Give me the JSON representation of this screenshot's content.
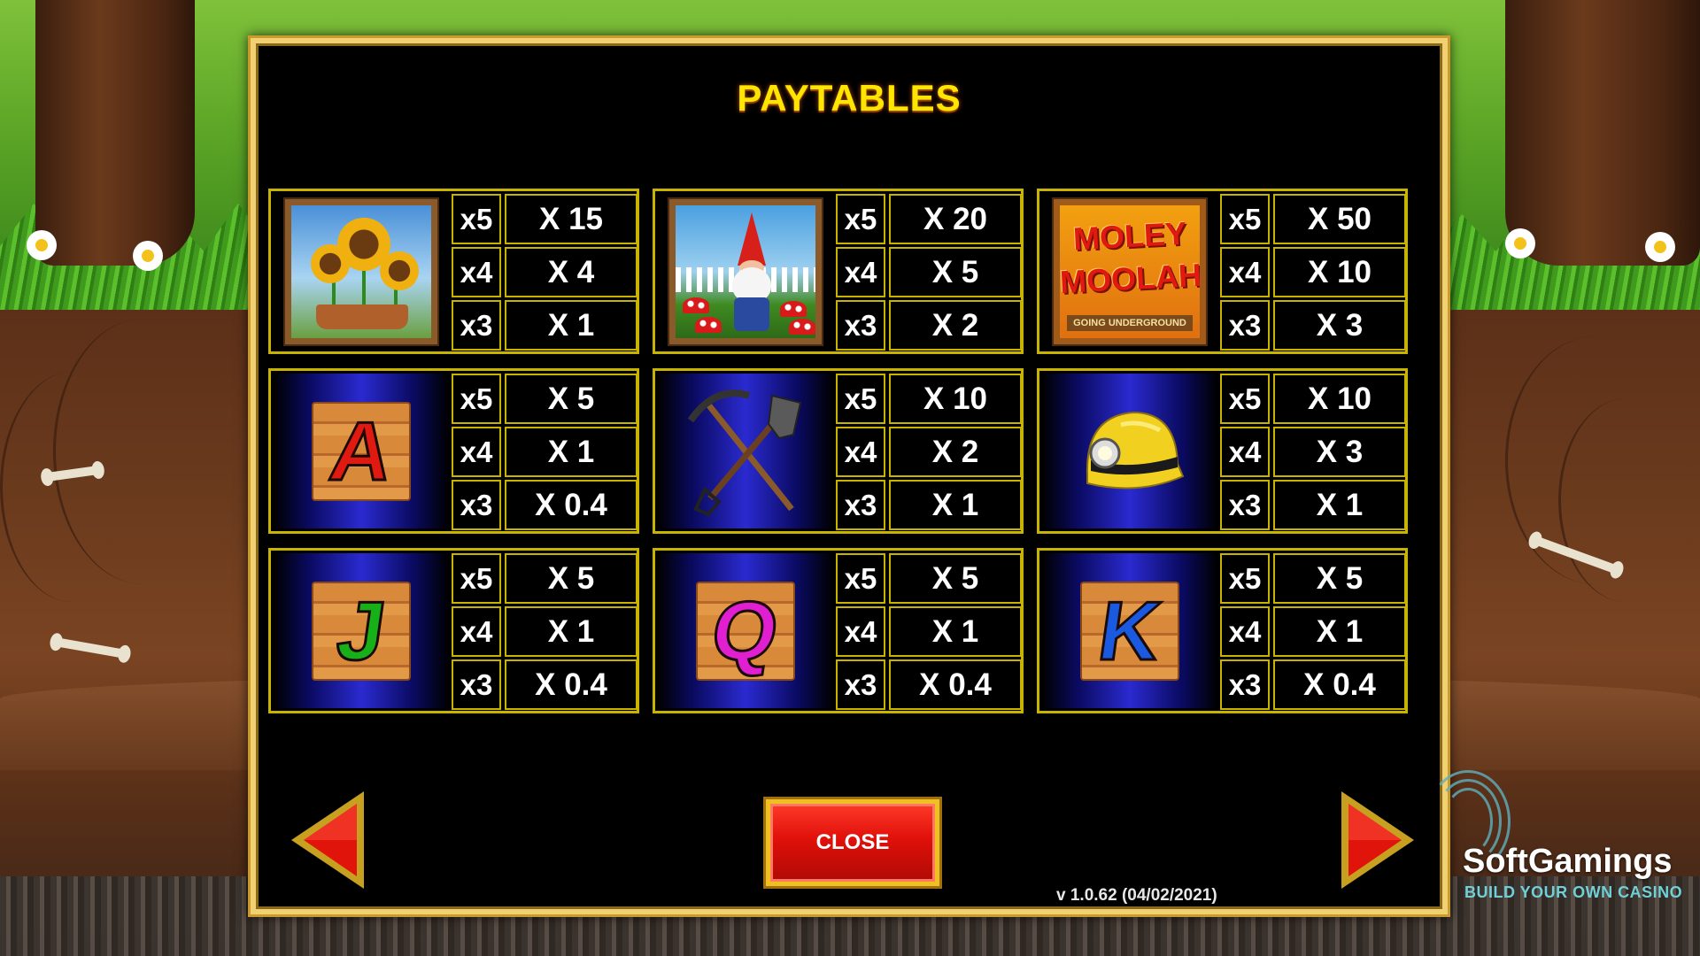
{
  "title": "PAYTABLES",
  "symbols": [
    {
      "name": "sunflowers",
      "pays": [
        {
          "count": "x5",
          "value": "X 15"
        },
        {
          "count": "x4",
          "value": "X 4"
        },
        {
          "count": "x3",
          "value": "X 1"
        }
      ]
    },
    {
      "name": "gnome",
      "pays": [
        {
          "count": "x5",
          "value": "X 20"
        },
        {
          "count": "x4",
          "value": "X 5"
        },
        {
          "count": "x3",
          "value": "X 2"
        }
      ]
    },
    {
      "name": "moley-moolah-logo",
      "logo_line1": "MOLEY",
      "logo_line2": "MOOLAH!",
      "logo_sub": "GOING UNDERGROUND",
      "pays": [
        {
          "count": "x5",
          "value": "X 50"
        },
        {
          "count": "x4",
          "value": "X 10"
        },
        {
          "count": "x3",
          "value": "X 3"
        }
      ]
    },
    {
      "name": "letter-a",
      "letter": "A",
      "pays": [
        {
          "count": "x5",
          "value": "X 5"
        },
        {
          "count": "x4",
          "value": "X 1"
        },
        {
          "count": "x3",
          "value": "X 0.4"
        }
      ]
    },
    {
      "name": "pickaxe-shovel",
      "pays": [
        {
          "count": "x5",
          "value": "X 10"
        },
        {
          "count": "x4",
          "value": "X 2"
        },
        {
          "count": "x3",
          "value": "X 1"
        }
      ]
    },
    {
      "name": "miner-helmet",
      "pays": [
        {
          "count": "x5",
          "value": "X 10"
        },
        {
          "count": "x4",
          "value": "X 3"
        },
        {
          "count": "x3",
          "value": "X 1"
        }
      ]
    },
    {
      "name": "letter-j",
      "letter": "J",
      "pays": [
        {
          "count": "x5",
          "value": "X 5"
        },
        {
          "count": "x4",
          "value": "X 1"
        },
        {
          "count": "x3",
          "value": "X 0.4"
        }
      ]
    },
    {
      "name": "letter-q",
      "letter": "Q",
      "pays": [
        {
          "count": "x5",
          "value": "X 5"
        },
        {
          "count": "x4",
          "value": "X 1"
        },
        {
          "count": "x3",
          "value": "X 0.4"
        }
      ]
    },
    {
      "name": "letter-k",
      "letter": "K",
      "pays": [
        {
          "count": "x5",
          "value": "X 5"
        },
        {
          "count": "x4",
          "value": "X 1"
        },
        {
          "count": "x3",
          "value": "X 0.4"
        }
      ]
    }
  ],
  "buttons": {
    "close": "CLOSE",
    "prev_icon": "triangle-left-icon",
    "next_icon": "triangle-right-icon"
  },
  "version": "v 1.0.62 (04/02/2021)",
  "watermark": {
    "brand": "SoftGamings",
    "tagline": "BUILD YOUR OWN CASINO"
  },
  "colors": {
    "title": "#ffe600",
    "grid_border": "#c8b400",
    "close_button": "#e0100a",
    "frame_gold": "#c99a2e",
    "letter_a": "#e01a10",
    "letter_j": "#18b018",
    "letter_q": "#e020d0",
    "letter_k": "#1a5ae0"
  }
}
